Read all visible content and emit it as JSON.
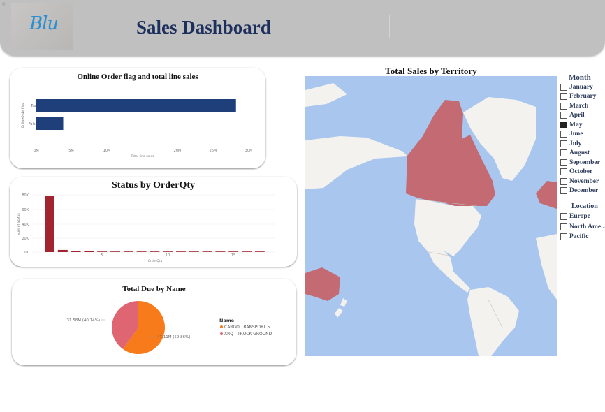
{
  "header": {
    "title": "Sales Dashboard",
    "logo_text": "Blu"
  },
  "online_chart": {
    "title": "Online Order flag and total line sales",
    "ylabel": "OnlineOrderFlag",
    "xlabel": "Total line sales",
    "ticks": [
      "0M",
      "5M",
      "10M",
      "20M",
      "25M",
      "30M"
    ],
    "chart_data": {
      "type": "bar",
      "orientation": "horizontal",
      "categories": [
        "True",
        "False"
      ],
      "values": [
        28.2,
        3.8
      ],
      "xlabel": "Total line sales",
      "ylabel": "OnlineOrderFlag",
      "xlim": [
        0,
        30
      ],
      "tick_values": [
        0,
        5,
        10,
        20,
        25,
        30
      ],
      "color": "#1f3f7a"
    }
  },
  "status_chart": {
    "title": "Status by OrderQty",
    "ylabel": "Sum of Status",
    "xlabel": "OrderQty",
    "yticks": [
      "80K",
      "60K",
      "40K",
      "20K",
      "0K"
    ],
    "xticks": [
      "5",
      "10",
      "15"
    ],
    "chart_data": {
      "type": "bar",
      "x": [
        1,
        2,
        3,
        4,
        5,
        6,
        7,
        8,
        9,
        10,
        11,
        12,
        13,
        14,
        15,
        16,
        17
      ],
      "values": [
        79000,
        3000,
        1800,
        1100,
        700,
        500,
        400,
        300,
        250,
        200,
        180,
        150,
        130,
        110,
        100,
        90,
        80
      ],
      "ylim": [
        0,
        80000
      ],
      "color": "#a1242e"
    }
  },
  "total_due": {
    "title": "Total Due by Name",
    "legend_title": "Name",
    "legend": [
      "CARGO TRANSPORT 5",
      "XRQ - TRUCK GROUND"
    ],
    "labels": [
      "31.58M (40.14%)",
      "47.11M (59.86%)"
    ],
    "chart_data": {
      "type": "pie",
      "categories": [
        "CARGO TRANSPORT 5",
        "XRQ - TRUCK GROUND"
      ],
      "values": [
        47.11,
        31.58
      ],
      "percent": [
        59.86,
        40.14
      ],
      "colors": [
        "#f77b1a",
        "#df6572"
      ]
    }
  },
  "map": {
    "title": "Total Sales by Territory",
    "ocean": "#a8c6ee",
    "highlight": "#c46a72"
  },
  "month_slicer": {
    "title": "Month",
    "items": [
      {
        "label": "January",
        "checked": false
      },
      {
        "label": "February",
        "checked": false
      },
      {
        "label": "March",
        "checked": false
      },
      {
        "label": "April",
        "checked": false
      },
      {
        "label": "May",
        "checked": true
      },
      {
        "label": "June",
        "checked": false
      },
      {
        "label": "July",
        "checked": false
      },
      {
        "label": "August",
        "checked": false
      },
      {
        "label": "September",
        "checked": false
      },
      {
        "label": "October",
        "checked": false
      },
      {
        "label": "November",
        "checked": false
      },
      {
        "label": "December",
        "checked": false
      }
    ]
  },
  "location_slicer": {
    "title": "Location",
    "items": [
      {
        "label": "Europe",
        "checked": false
      },
      {
        "label": "North Ame...",
        "checked": false
      },
      {
        "label": "Pacific",
        "checked": false
      }
    ]
  }
}
